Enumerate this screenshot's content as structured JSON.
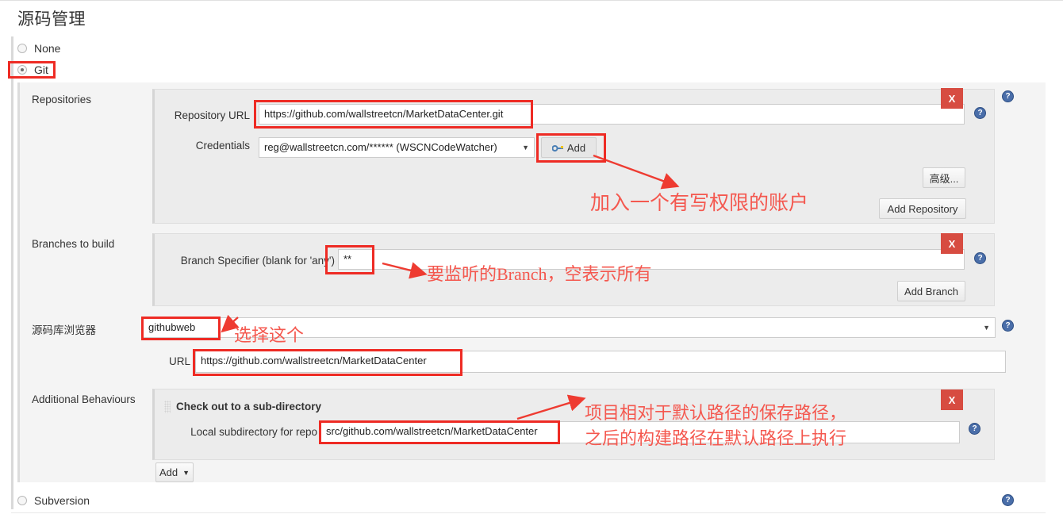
{
  "page": {
    "title": "源码管理"
  },
  "scm_options": [
    {
      "label": "None",
      "checked": false
    },
    {
      "label": "Git",
      "checked": true
    },
    {
      "label": "Subversion",
      "checked": false
    }
  ],
  "sections": {
    "repositories": {
      "label": "Repositories",
      "repository_url": {
        "label": "Repository URL",
        "value": "https://github.com/wallstreetcn/MarketDataCenter.git"
      },
      "credentials": {
        "label": "Credentials",
        "value": "reg@wallstreetcn.com/****** (WSCNCodeWatcher)",
        "add_button": "Add"
      },
      "advanced_button": "高级...",
      "add_repository_button": "Add Repository",
      "delete_label": "X"
    },
    "branches": {
      "label": "Branches to build",
      "branch_specifier": {
        "label": "Branch Specifier (blank for 'any')",
        "value": "**"
      },
      "add_branch_button": "Add Branch",
      "delete_label": "X"
    },
    "repository_browser": {
      "label": "源码库浏览器",
      "value": "githubweb",
      "url": {
        "label": "URL",
        "value": "https://github.com/wallstreetcn/MarketDataCenter"
      }
    },
    "additional_behaviours": {
      "label": "Additional Behaviours",
      "behaviour_title": "Check out to a sub-directory",
      "local_subdirectory": {
        "label": "Local subdirectory for repo",
        "value": "src/github.com/wallstreetcn/MarketDataCenter"
      },
      "add_button": "Add",
      "delete_label": "X"
    }
  },
  "help_icon": "?",
  "annotations": [
    {
      "id": "credentials-note",
      "text": "加入一个有写权限的账户"
    },
    {
      "id": "branch-note",
      "text": "要监听的Branch，空表示所有"
    },
    {
      "id": "browser-note",
      "text": "选择这个"
    },
    {
      "id": "subdir-note-line1",
      "text": "项目相对于默认路径的保存路径，"
    },
    {
      "id": "subdir-note-line2",
      "text": "之后的构建路径在默认路径上执行"
    }
  ],
  "colors": {
    "annotation_red": "#f4584f",
    "highlight_box_red": "#ee2b24",
    "delete_button_red": "#d74c41",
    "help_blue": "#4a6ea9"
  }
}
